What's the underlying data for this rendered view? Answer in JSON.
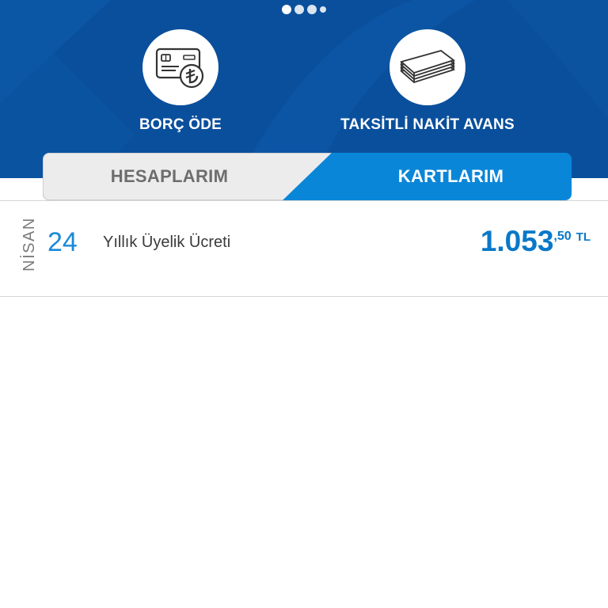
{
  "carousel": {
    "page_count": 4,
    "active_page": 1
  },
  "quick_actions": [
    {
      "label": "BORÇ ÖDE",
      "icon": "card-lira-icon"
    },
    {
      "label": "TAKSİTLİ NAKİT AVANS",
      "icon": "cash-stack-icon"
    }
  ],
  "tabs": [
    {
      "label": "HESAPLARIM",
      "selected": false
    },
    {
      "label": "KARTLARIM",
      "selected": true
    }
  ],
  "transactions": [
    {
      "month": "NİSAN",
      "day": "24",
      "description": "Yıllık Üyelik Ücreti",
      "amount_integer": "1.053",
      "amount_decimal": ",50",
      "currency": "TL"
    }
  ],
  "colors": {
    "hero_background": "#0a4f9c",
    "active_tab": "#0a86d8",
    "inactive_tab": "#ececec",
    "amount": "#0a78c8",
    "day": "#1a8ad6"
  }
}
